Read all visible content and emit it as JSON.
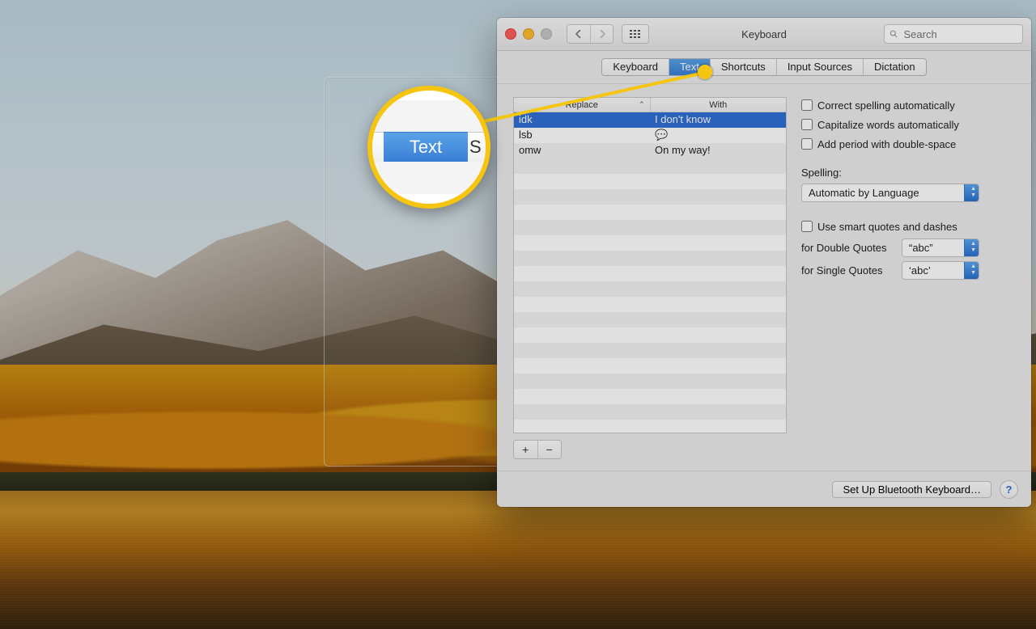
{
  "window": {
    "title": "Keyboard",
    "search_placeholder": "Search"
  },
  "tabs": {
    "items": [
      "Keyboard",
      "Text",
      "Shortcuts",
      "Input Sources",
      "Dictation"
    ],
    "active_index": 1
  },
  "table": {
    "headers": {
      "replace": "Replace",
      "with": "With"
    },
    "rows": [
      {
        "replace": "idk",
        "with": "I don't know",
        "selected": true
      },
      {
        "replace": "lsb",
        "with": "💬",
        "selected": false
      },
      {
        "replace": "omw",
        "with": "On my way!",
        "selected": false
      }
    ]
  },
  "options": {
    "correct_spelling": {
      "label": "Correct spelling automatically",
      "checked": false
    },
    "capitalize": {
      "label": "Capitalize words automatically",
      "checked": false
    },
    "double_space_period": {
      "label": "Add period with double-space",
      "checked": false
    },
    "spelling_label": "Spelling:",
    "spelling_value": "Automatic by Language",
    "smart_quotes": {
      "label": "Use smart quotes and dashes",
      "checked": false
    },
    "double_quotes": {
      "label": "for Double Quotes",
      "value": "“abc”"
    },
    "single_quotes": {
      "label": "for Single Quotes",
      "value": "‘abc’"
    }
  },
  "footer": {
    "bluetooth": "Set Up Bluetooth Keyboard…",
    "help": "?"
  },
  "callout": {
    "label": "Text",
    "right_fragment": "S"
  }
}
